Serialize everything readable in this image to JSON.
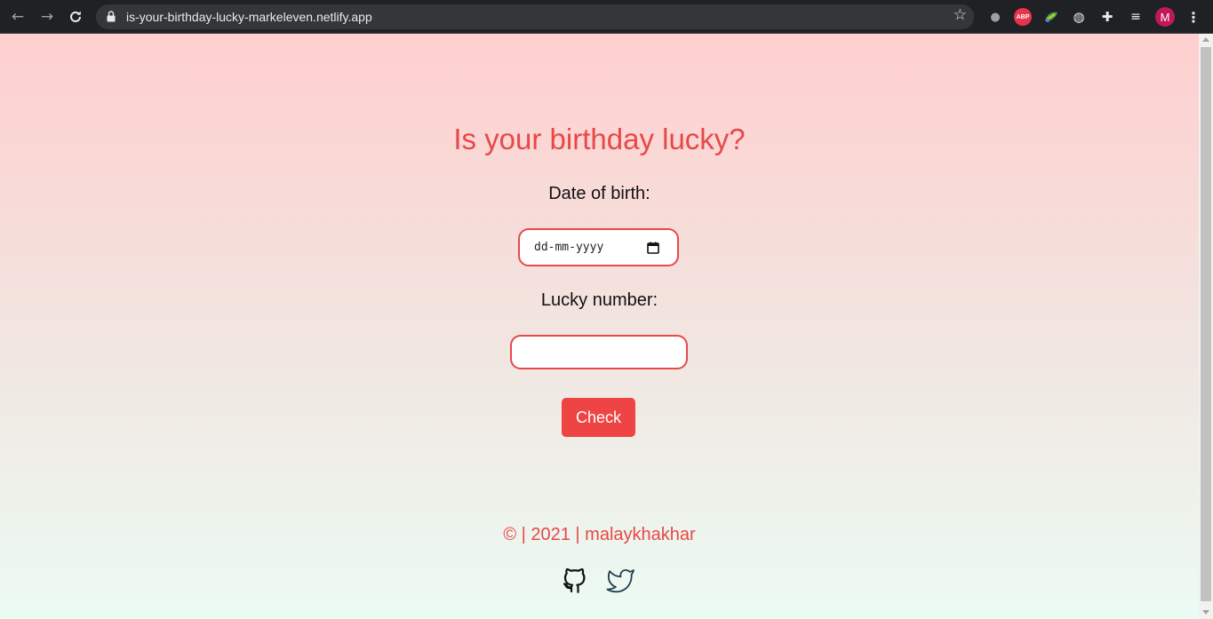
{
  "browser": {
    "url": "is-your-birthday-lucky-markeleven.netlify.app",
    "avatar_letter": "M",
    "abp_label": "ABP"
  },
  "page": {
    "title": "Is your birthday lucky?",
    "dob_label": "Date of birth:",
    "dob_placeholder": "dd-mm-yyyy",
    "lucky_label": "Lucky number:",
    "lucky_value": "",
    "check_label": "Check",
    "footer_text": "© | 2021 | malaykhakhar"
  },
  "colors": {
    "accent": "#e84848",
    "button": "#ef4444",
    "gradient_top": "#ffcfcf",
    "gradient_bottom": "#ebfbf3"
  },
  "icons": [
    "back-arrow-icon",
    "forward-arrow-icon",
    "reload-icon",
    "lock-icon",
    "star-icon",
    "mic-icon",
    "adblock-icon",
    "leaf-icon",
    "globe-icon",
    "puzzle-icon",
    "media-queue-icon",
    "kebab-menu-icon",
    "calendar-icon",
    "github-icon",
    "twitter-icon"
  ]
}
